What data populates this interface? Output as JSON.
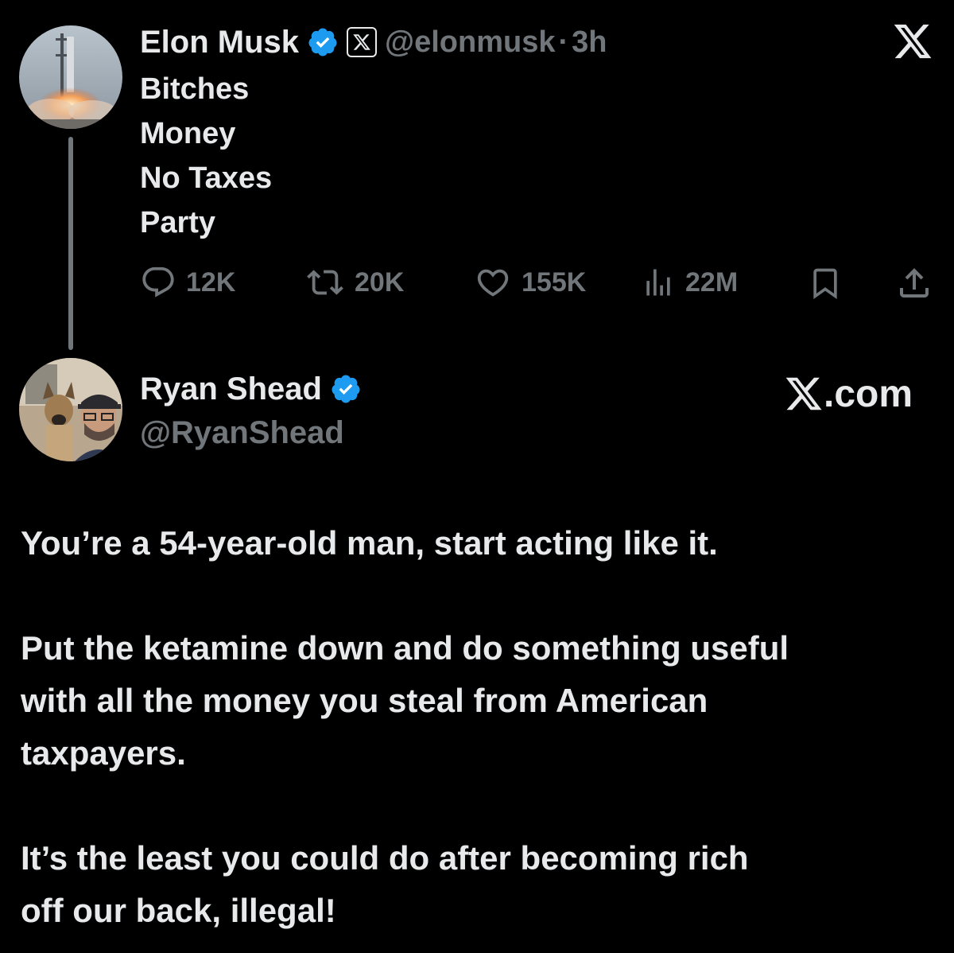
{
  "elon_tweet": {
    "name": "Elon Musk",
    "handle": "@elonmusk",
    "separator": "·",
    "time": "3h",
    "lines": [
      "Bitches",
      "Money",
      "No Taxes",
      "Party"
    ],
    "stats": {
      "replies": "12K",
      "reposts": "20K",
      "likes": "155K",
      "views": "22M"
    },
    "icons": [
      "verified-badge-icon",
      "x-affiliate-badge-icon",
      "x-logo-icon",
      "reply-icon",
      "repost-icon",
      "like-icon",
      "views-icon",
      "bookmark-icon",
      "share-icon"
    ]
  },
  "reply_tweet": {
    "name": "Ryan Shead",
    "handle": "@RyanShead",
    "site_label": "X.com",
    "paragraphs": [
      [
        "You’re a 54-year-old man, start acting like it."
      ],
      [
        "Put the ketamine down and do something useful",
        "with all the money you steal from American",
        "taxpayers."
      ],
      [
        "It’s the least you could do after becoming rich",
        "off our back, illegal!"
      ]
    ]
  },
  "colors": {
    "background": "#000000",
    "text": "#e7e9ea",
    "muted": "#71767b",
    "verified": "#1d9bf0"
  }
}
